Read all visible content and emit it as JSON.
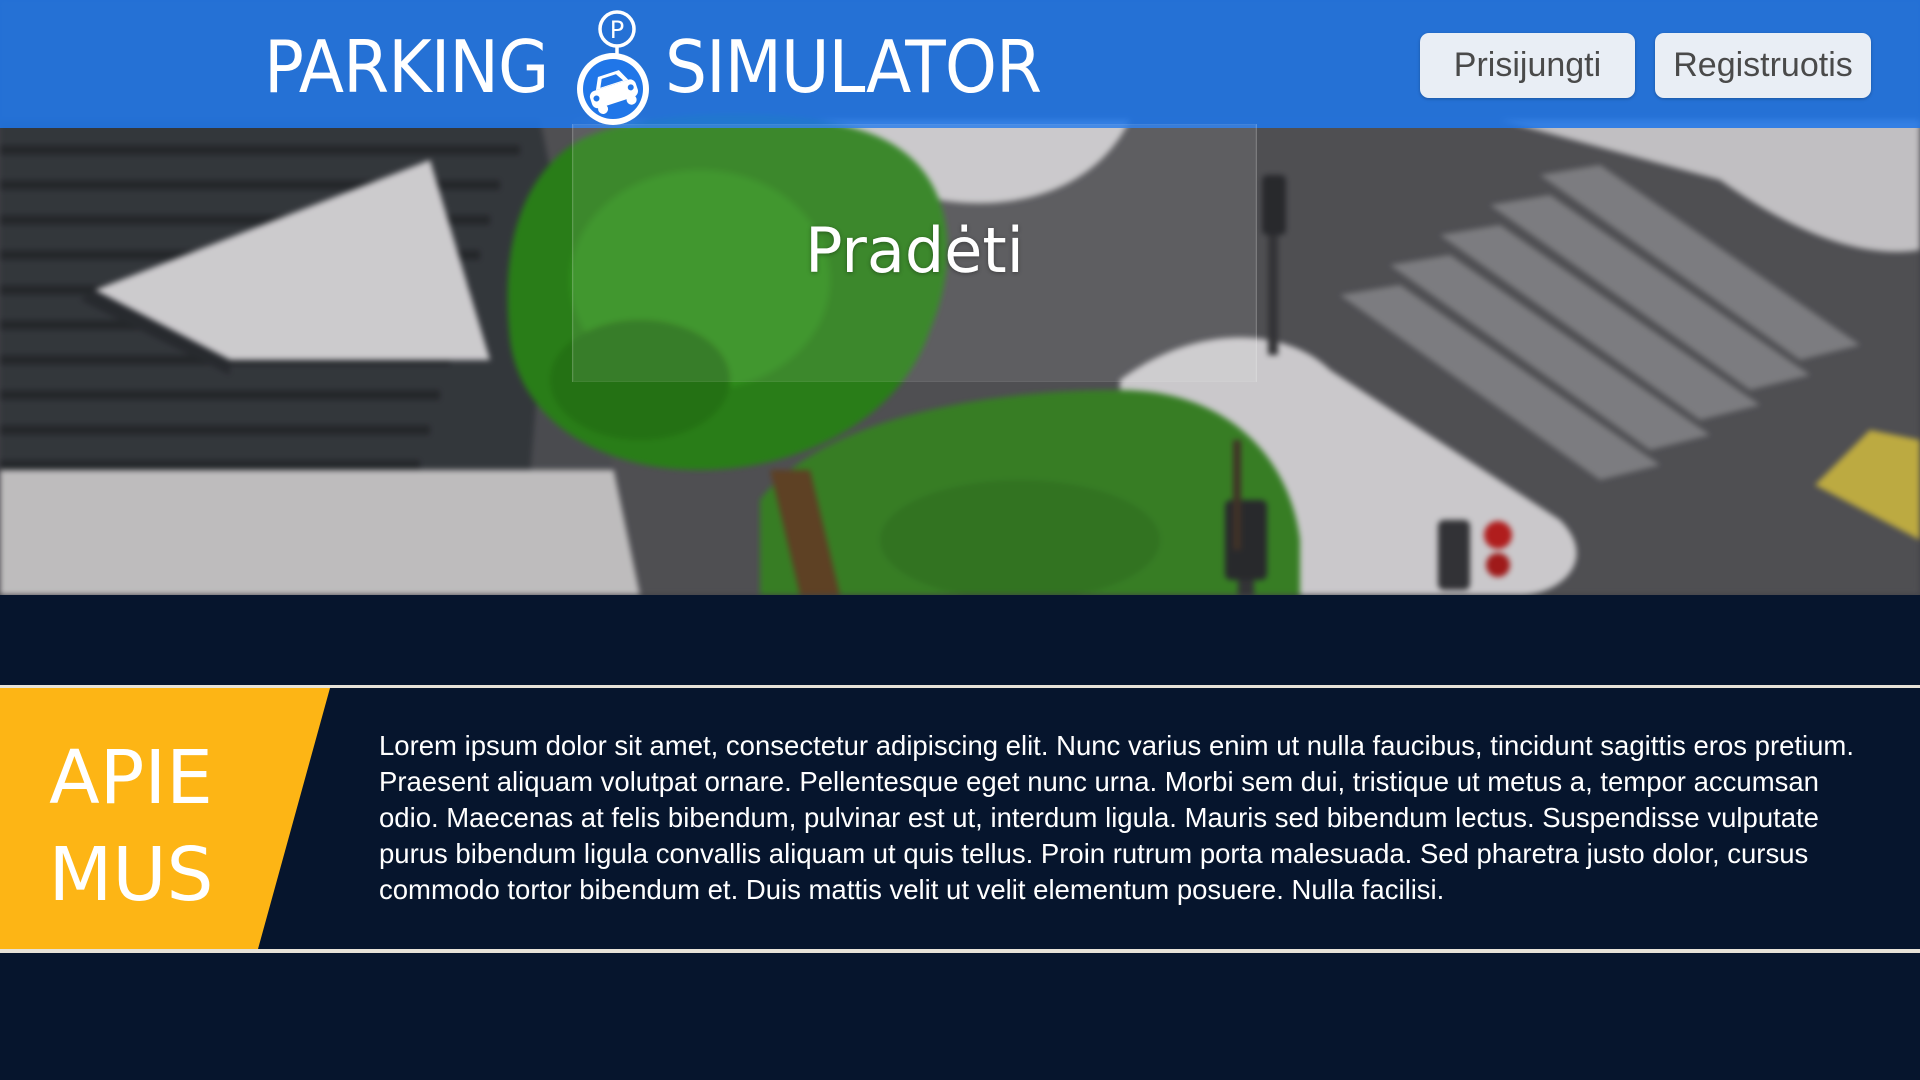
{
  "header": {
    "logo": {
      "word_left": "PARKING",
      "word_right": "SIMULATOR",
      "badge_letter": "P",
      "badge_icon": "car-parking-pin-icon"
    },
    "buttons": {
      "login_label": "Prisijungti",
      "register_label": "Registruotis"
    }
  },
  "hero": {
    "start_label": "Pradėti"
  },
  "about": {
    "title_line1": "APIE",
    "title_line2": "MUS",
    "body": "Lorem ipsum dolor sit amet, consectetur adipiscing elit. Nunc varius enim ut nulla faucibus, tincidunt sagittis eros pretium. Praesent aliquam volutpat ornare. Pellentesque eget nunc urna. Morbi sem dui, tristique ut metus a, tempor accumsan odio. Maecenas at felis bibendum, pulvinar est ut, interdum ligula. Mauris sed bibendum lectus. Suspendisse  vulputate purus bibendum ligula convallis aliquam ut quis tellus. Proin rutrum porta malesuada. Sed pharetra justo dolor, cursus commodo tortor bibendum et. Duis mattis velit ut velit elementum posuere. Nulla facilisi."
  },
  "colors": {
    "header_blue": "#2076e8",
    "page_navy": "#06152d",
    "about_accent": "#fdb515",
    "button_bg": "#e9eef5"
  }
}
